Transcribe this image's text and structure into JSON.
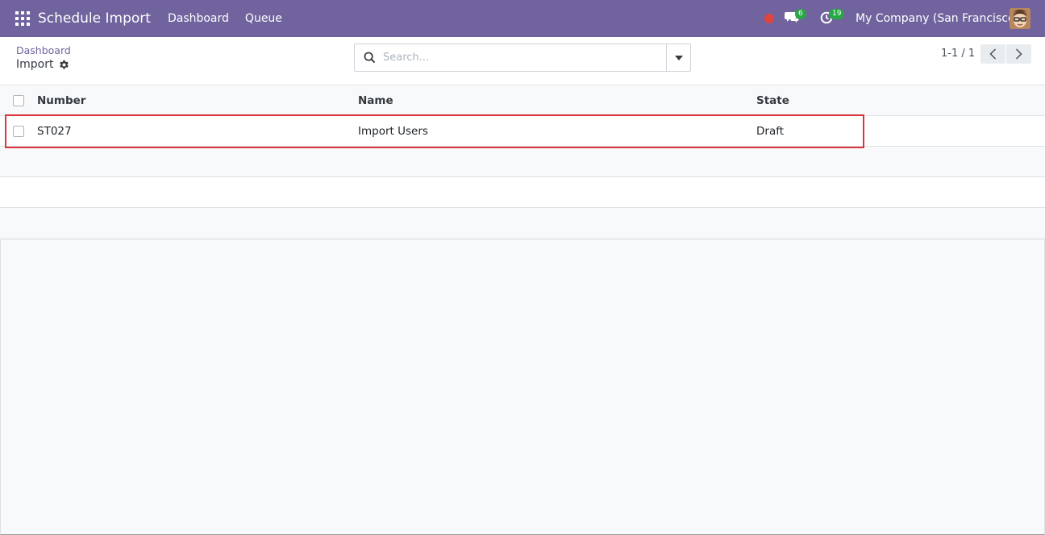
{
  "navbar": {
    "app_title": "Schedule Import",
    "menu": [
      "Dashboard",
      "Queue"
    ],
    "messages_count": "6",
    "activities_count": "19",
    "company": "My Company (San Francisco)"
  },
  "control_panel": {
    "breadcrumb": "Dashboard",
    "title": "Import",
    "search_placeholder": "Search...",
    "pager": "1-1 / 1"
  },
  "list": {
    "columns": [
      "Number",
      "Name",
      "State"
    ],
    "rows": [
      {
        "number": "ST027",
        "name": "Import Users",
        "state": "Draft"
      }
    ]
  },
  "colors": {
    "navbar": "#71639e",
    "highlight": "#d9363e",
    "badge": "#28a745"
  }
}
